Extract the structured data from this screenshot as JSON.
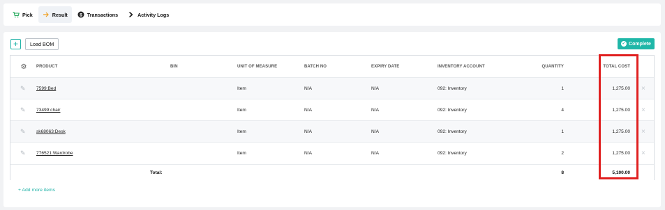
{
  "tabs": [
    {
      "label": "Pick",
      "icon": "cart-icon"
    },
    {
      "label": "Result",
      "icon": "arrow-right-icon"
    },
    {
      "label": "Transactions",
      "icon": "dollar-circle-icon"
    },
    {
      "label": "Activity Logs",
      "icon": "play-arrow-icon"
    }
  ],
  "toolbar": {
    "add_label": "+",
    "load_bom_label": "Load BOM",
    "complete_label": "Complete"
  },
  "table": {
    "headers": [
      "PRODUCT",
      "BIN",
      "UNIT OF MEASURE",
      "BATCH NO",
      "EXPIRY DATE",
      "INVENTORY ACCOUNT",
      "QUANTITY",
      "TOTAL COST"
    ],
    "rows": [
      {
        "product": "7599:Bed",
        "bin": "",
        "uom": "Item",
        "batch": "N/A",
        "expiry": "N/A",
        "account": "092: Inventory",
        "quantity": "1",
        "total": "1,275.00"
      },
      {
        "product": "73499:chair",
        "bin": "",
        "uom": "Item",
        "batch": "N/A",
        "expiry": "N/A",
        "account": "092: Inventory",
        "quantity": "4",
        "total": "1,275.00"
      },
      {
        "product": "sk68063:Desk",
        "bin": "",
        "uom": "Item",
        "batch": "N/A",
        "expiry": "N/A",
        "account": "092: Inventory",
        "quantity": "1",
        "total": "1,275.00"
      },
      {
        "product": "776521:Wardrobe",
        "bin": "",
        "uom": "Item",
        "batch": "N/A",
        "expiry": "N/A",
        "account": "092: Inventory",
        "quantity": "2",
        "total": "1,275.00"
      }
    ],
    "total_label": "Total:",
    "total_quantity": "8",
    "total_cost": "5,100.00"
  },
  "add_more_label": "+ Add more items",
  "colors": {
    "accent": "#1fb7a8",
    "highlight": "#e02020"
  }
}
